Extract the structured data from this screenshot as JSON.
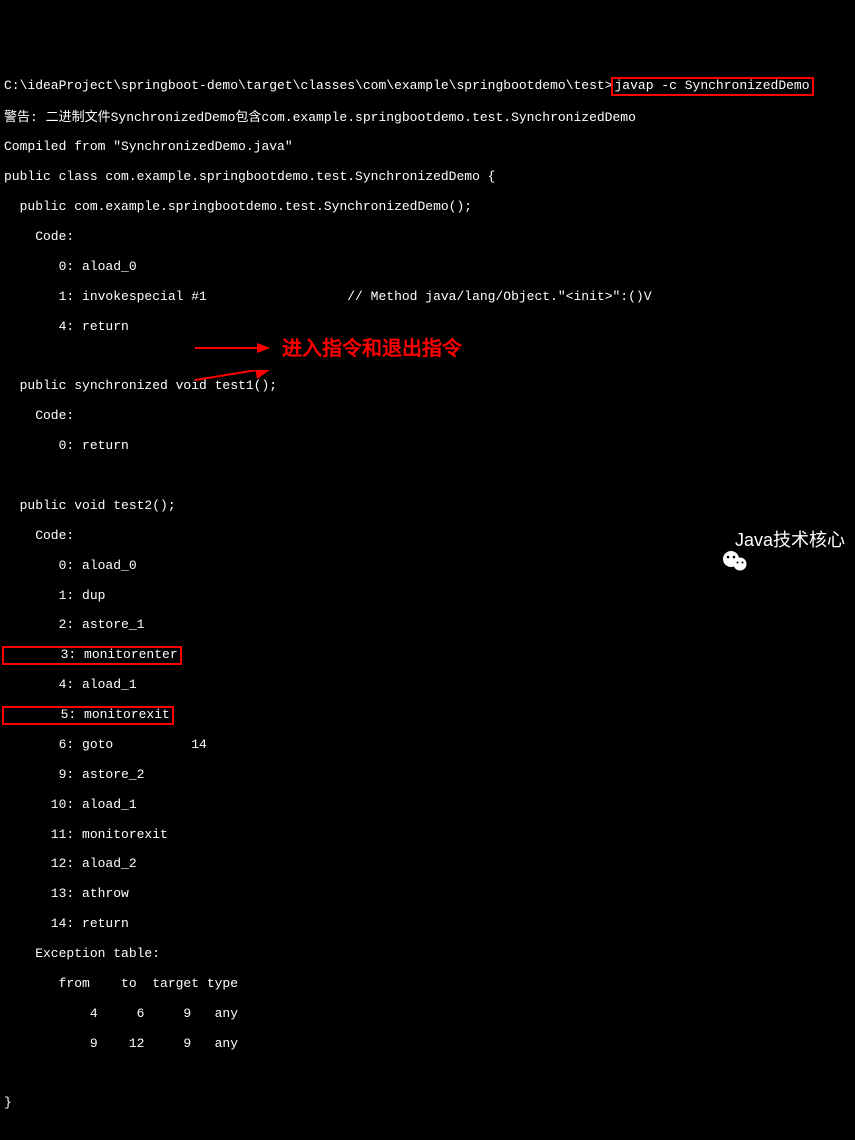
{
  "prompt_path": "C:\\ideaProject\\springboot-demo\\target\\classes\\com\\example\\springbootdemo\\test>",
  "command": "javap -c SynchronizedDemo",
  "warning": "警告: 二进制文件SynchronizedDemo包含com.example.springbootdemo.test.SynchronizedDemo",
  "compiled_from": "Compiled from \"SynchronizedDemo.java\"",
  "class_decl": "public class com.example.springbootdemo.test.SynchronizedDemo {",
  "constructor": "  public com.example.springbootdemo.test.SynchronizedDemo();",
  "code_label": "    Code:",
  "ctor_lines": [
    "       0: aload_0",
    "       1: invokespecial #1                  // Method java/lang/Object.\"<init>\":()V",
    "       4: return"
  ],
  "test1_sig": "  public synchronized void test1();",
  "test1_lines": [
    "       0: return"
  ],
  "test2_sig": "  public void test2();",
  "test2_pre": [
    "       0: aload_0",
    "       1: dup",
    "       2: astore_1"
  ],
  "monitorenter": "       3: monitorenter",
  "between": "       4: aload_1",
  "monitorexit": "       5: monitorexit",
  "test2_post": [
    "       6: goto          14",
    "       9: astore_2",
    "      10: aload_1",
    "      11: monitorexit",
    "      12: aload_2",
    "      13: athrow",
    "      14: return"
  ],
  "exception_table": "    Exception table:",
  "exception_header": "       from    to  target type",
  "exception_rows": [
    "           4     6     9   any",
    "           9    12     9   any"
  ],
  "close_brace": "}",
  "annotation_text": "进入指令和退出指令",
  "watermark_text": "Java技术核心"
}
